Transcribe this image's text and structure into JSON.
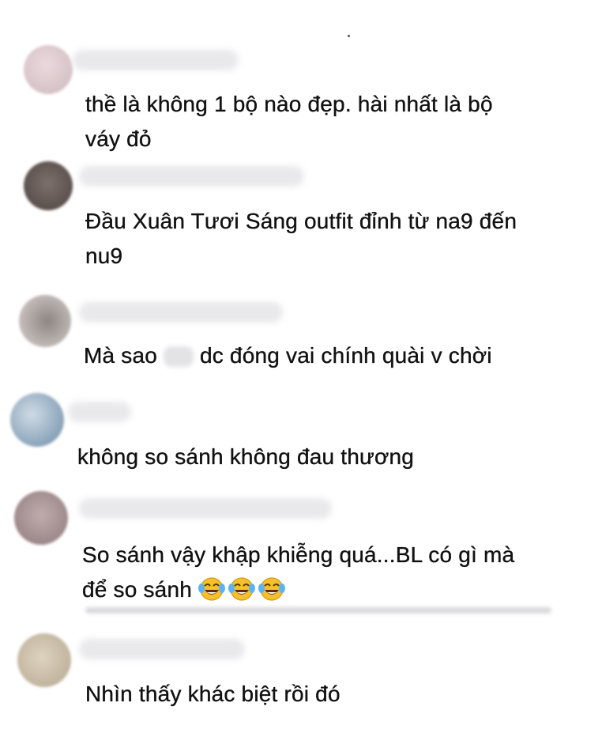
{
  "comments": [
    {
      "text": "thề là không 1 bộ nào đẹp. hài nhất là bộ\nváy đỏ",
      "avatar_color": "#dccbd0"
    },
    {
      "text": "Đầu Xuân Tươi Sáng outfit đỉnh từ na9 đến\nnu9",
      "avatar_color": "#6e6460"
    },
    {
      "text_before": "Mà sao ",
      "text_after": " dc đóng vai chính quài v chời",
      "avatar_color": "#b0aaa8"
    },
    {
      "text": "không so sánh không đau thương",
      "avatar_color": "#9fb5c8"
    },
    {
      "text": "So sánh vậy khập khiễng quá...BL có gì mà\nđể so sánh",
      "emoji": [
        "face-with-tears-of-joy-icon",
        "face-with-tears-of-joy-icon",
        "face-with-tears-of-joy-icon"
      ],
      "avatar_color": "#b5a2a2"
    },
    {
      "text": "Nhìn thấy khác biệt rồi đó",
      "avatar_color": "#c9bda8"
    }
  ]
}
